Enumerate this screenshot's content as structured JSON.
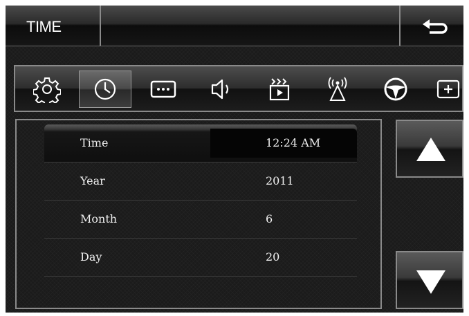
{
  "header": {
    "title": "TIME"
  },
  "toolbar": {
    "icons": [
      {
        "name": "gear-icon"
      },
      {
        "name": "clock-icon",
        "active": true
      },
      {
        "name": "more-icon"
      },
      {
        "name": "speaker-icon"
      },
      {
        "name": "media-icon"
      },
      {
        "name": "antenna-icon"
      },
      {
        "name": "steering-wheel-icon"
      },
      {
        "name": "add-icon"
      }
    ]
  },
  "settings": {
    "rows": [
      {
        "label": "Time",
        "value": "12:24 AM"
      },
      {
        "label": "Year",
        "value": "2011"
      },
      {
        "label": "Month",
        "value": "6"
      },
      {
        "label": "Day",
        "value": "20"
      }
    ]
  },
  "colors": {
    "background": "#1b1b1b",
    "text": "#ffffff",
    "border": "#8a8a8a"
  }
}
